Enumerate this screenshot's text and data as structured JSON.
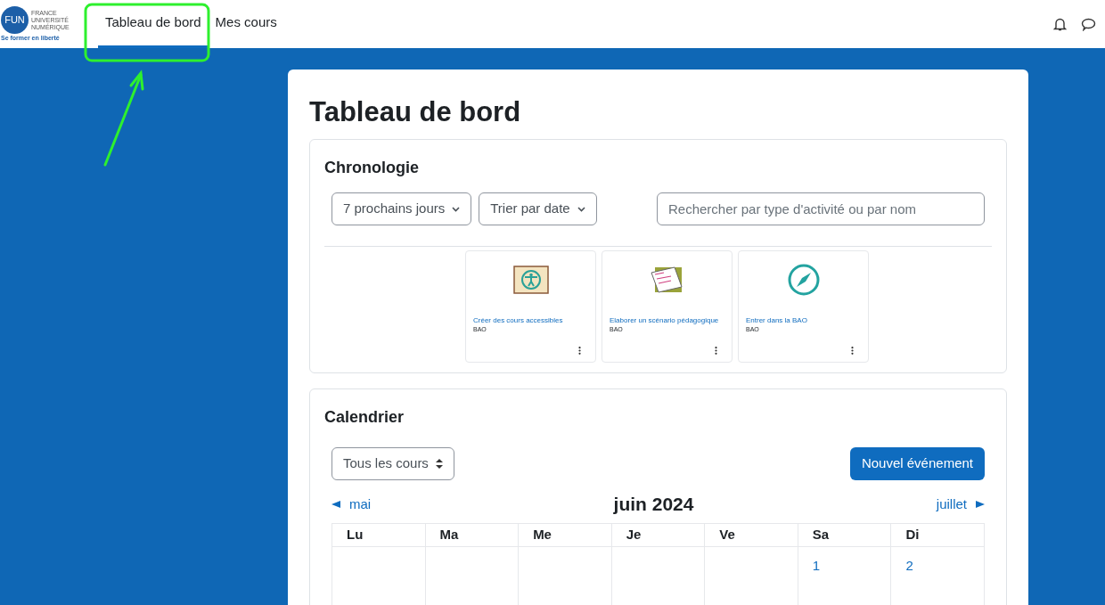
{
  "logo": {
    "mark": "FUN",
    "org_lines": [
      "FRANCE",
      "UNIVERSITÉ",
      "NUMÉRIQUE"
    ],
    "tagline": "Se former en liberté"
  },
  "nav": [
    {
      "label": "Tableau de bord",
      "selected": true
    },
    {
      "label": "Mes cours",
      "selected": false
    }
  ],
  "page_title": "Tableau de bord",
  "timeline": {
    "title": "Chronologie",
    "filters": [
      "7 prochains jours",
      "Trier par date"
    ],
    "search": {
      "placeholder": "Rechercher par type d'activité ou par nom"
    },
    "courses": [
      {
        "kind": "accessibility",
        "name": "Créer des cours accessibles",
        "category": "BAO"
      },
      {
        "kind": "scenario",
        "name": "Elaborer un scénario pédagogique",
        "category": "BAO"
      },
      {
        "kind": "compass",
        "name": "Entrer dans la BAO",
        "category": "BAO"
      }
    ]
  },
  "calendar": {
    "title": "Calendrier",
    "course_filter": "Tous les cours",
    "new_event": "Nouvel événement",
    "prev": "mai",
    "month": "juin 2024",
    "next": "juillet",
    "weekdays": [
      "Lu",
      "Ma",
      "Me",
      "Je",
      "Ve",
      "Sa",
      "Di"
    ],
    "weeks": [
      [
        "1",
        "2"
      ]
    ]
  }
}
